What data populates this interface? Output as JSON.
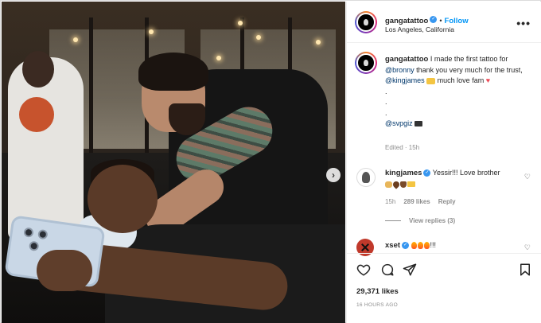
{
  "post": {
    "username": "gangatattoo",
    "follow_label": "Follow",
    "dot_separator": "•",
    "location": "Los Angeles, California",
    "more_label": "•••"
  },
  "caption": {
    "username": "gangatattoo",
    "text_1": " I made the first tattoo for ",
    "mention_1": "@bronny",
    "text_2": " thank you very much for the trust, ",
    "mention_2": "@kingjames",
    "text_3": " much love fam ",
    "dots": [
      ".",
      ".",
      "."
    ],
    "mention_3": "@svpgiz",
    "edited": "Edited · 15h"
  },
  "comments": [
    {
      "username": "kingjames",
      "text": " Yessir!!! Love brother",
      "time": "15h",
      "likes": "289 likes",
      "reply_label": "Reply",
      "view_replies": "View replies (3)"
    },
    {
      "username": "xset",
      "text": "!!!"
    }
  ],
  "footer": {
    "likes": "29,371 likes",
    "time_ago": "16 HOURS AGO"
  },
  "colors": {
    "accent": "#0095f6",
    "verified": "#3897f0",
    "heart": "#ed4956",
    "muted": "#8e8e8e"
  },
  "icons": [
    "heart-icon",
    "comment-icon",
    "share-icon",
    "bookmark-icon",
    "next-arrow-icon",
    "verified-icon",
    "more-icon"
  ]
}
